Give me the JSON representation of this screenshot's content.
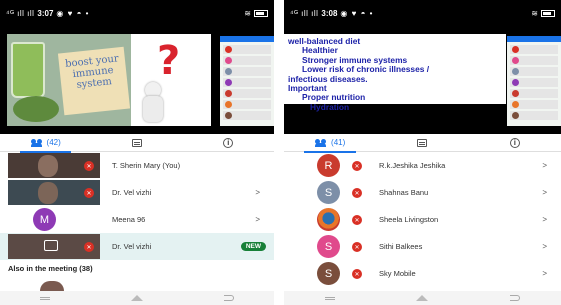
{
  "left": {
    "status": {
      "signal": "⁴ᴳ ıll ıll",
      "time": "3:07",
      "notifications": "◉ ♥ ◓ •"
    },
    "poster_text": "boost your immune system",
    "poster_symbol": "?",
    "tabs": {
      "people_count": "(42)"
    },
    "participants": [
      {
        "name": "T. Sherin Mary (You)",
        "avatar": "camera"
      },
      {
        "name": "Dr. Vel vizhi",
        "avatar": "camera"
      },
      {
        "name": "Meena 96",
        "avatar": "M",
        "color": "#8e3ab5"
      },
      {
        "name": "Dr. Vel vizhi",
        "avatar": "present",
        "badge": "NEW"
      }
    ],
    "also_heading": "Also in the meeting (38)"
  },
  "right": {
    "status": {
      "signal": "⁴ᴳ ıll ıll",
      "time": "3:08",
      "notifications": "◉ ♥ ◓ •"
    },
    "slide_lines": [
      "well-balanced diet",
      "Healthier",
      "Stronger immune systems",
      "Lower risk of chronic illnesses /",
      "infectious diseases.",
      "Important",
      "Proper nutrition",
      "Hydration"
    ],
    "tabs": {
      "people_count": "(41)"
    },
    "participants": [
      {
        "name": "R.k.Jeshika Jeshika",
        "avatar": "R",
        "color": "#c93b2e"
      },
      {
        "name": "Shahnas Banu",
        "avatar": "S",
        "color": "#7d8fa8"
      },
      {
        "name": "Sheela Livingston",
        "avatar": "photo",
        "color": "#e8752a"
      },
      {
        "name": "Sithi Balkees",
        "avatar": "S",
        "color": "#e04a8c"
      },
      {
        "name": "Sky Mobile",
        "avatar": "S",
        "color": "#7a4e3c"
      }
    ]
  },
  "icons": {
    "people": "people-icon",
    "chat": "chat-icon",
    "info": "info-icon",
    "mic_off": "mic-off-icon",
    "chevron": "chevron-right-icon"
  },
  "colors": {
    "accent": "#1a73e8",
    "mute": "#d93025",
    "new_badge": "#188038"
  }
}
